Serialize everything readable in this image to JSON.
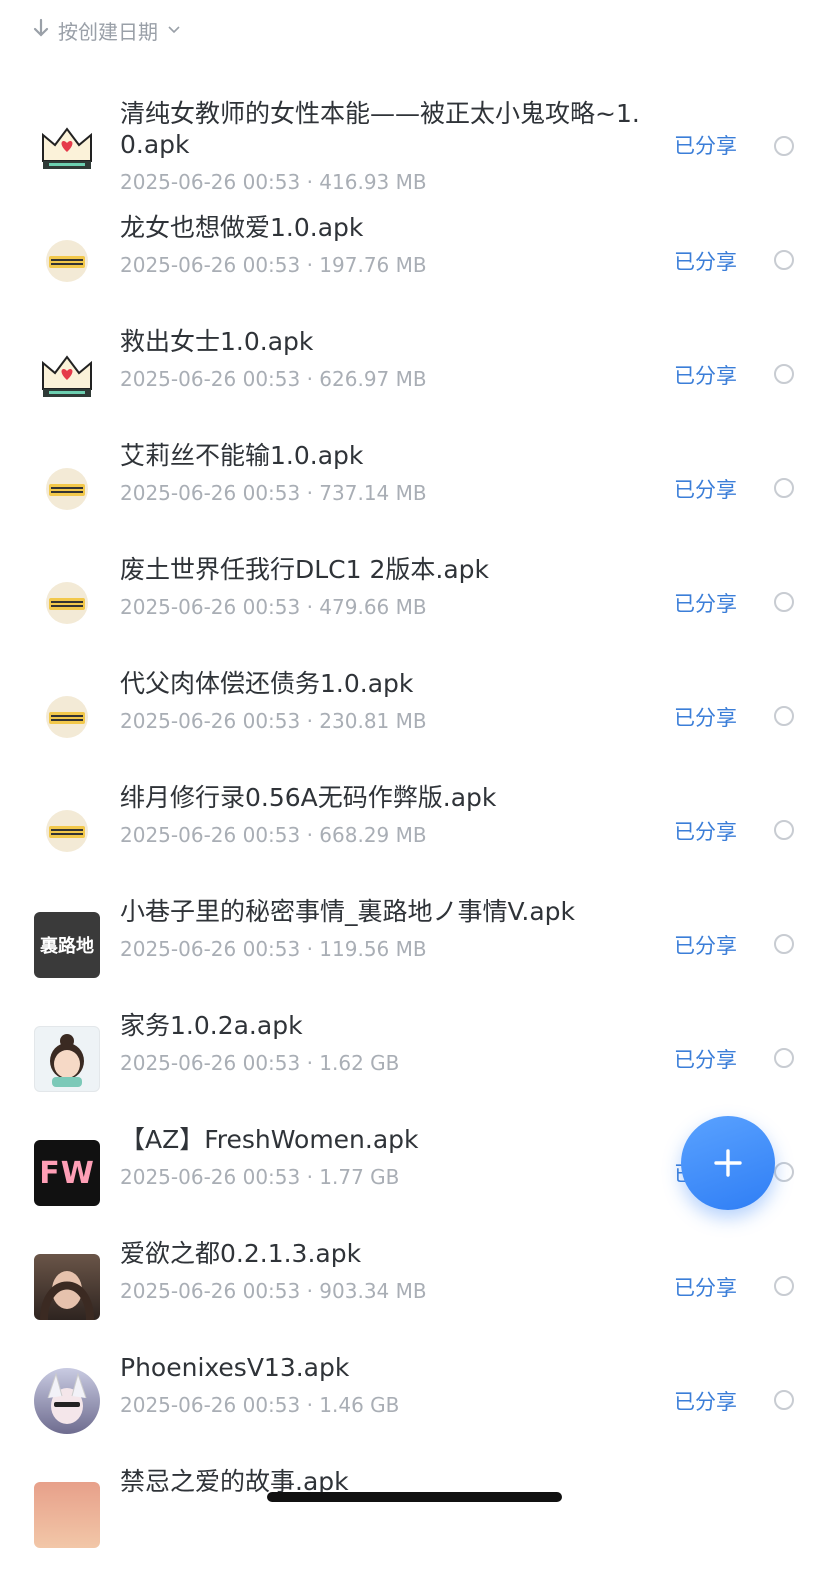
{
  "sort": {
    "label": "按创建日期"
  },
  "files": [
    {
      "name": "清纯女教师的女性本能——被正太小鬼攻略~1.0.apk",
      "meta": "2025-06-26 00:53 · 416.93 MB",
      "status": "已分享",
      "icon": "crown-icon"
    },
    {
      "name": "龙女也想做爱1.0.apk",
      "meta": "2025-06-26 00:53 · 197.76 MB",
      "status": "已分享",
      "icon": "site-logo-icon"
    },
    {
      "name": "救出女士1.0.apk",
      "meta": "2025-06-26 00:53 · 626.97 MB",
      "status": "已分享",
      "icon": "crown-icon"
    },
    {
      "name": "艾莉丝不能输1.0.apk",
      "meta": "2025-06-26 00:53 · 737.14 MB",
      "status": "已分享",
      "icon": "site-logo-icon"
    },
    {
      "name": "废土世界任我行DLC1 2版本.apk",
      "meta": "2025-06-26 00:53 · 479.66 MB",
      "status": "已分享",
      "icon": "site-logo-icon"
    },
    {
      "name": "代父肉体偿还债务1.0.apk",
      "meta": "2025-06-26 00:53 · 230.81 MB",
      "status": "已分享",
      "icon": "site-logo-icon"
    },
    {
      "name": "绯月修行录0.56A无码作弊版.apk",
      "meta": "2025-06-26 00:53 · 668.29 MB",
      "status": "已分享",
      "icon": "site-logo-icon"
    },
    {
      "name": "小巷子里的秘密事情_裏路地ノ事情V.apk",
      "meta": "2025-06-26 00:53 · 119.56 MB",
      "status": "已分享",
      "icon": "alley-game-icon"
    },
    {
      "name": "家务1.0.2a.apk",
      "meta": "2025-06-26 00:53 · 1.62 GB",
      "status": "已分享",
      "icon": "girl-avatar-icon"
    },
    {
      "name": "【AZ】FreshWomen.apk",
      "meta": "2025-06-26 00:53 · 1.77 GB",
      "status": "已分享",
      "icon": "fw-logo-icon"
    },
    {
      "name": "爱欲之都0.2.1.3.apk",
      "meta": "2025-06-26 00:53 · 903.34 MB",
      "status": "已分享",
      "icon": "portrait-icon"
    },
    {
      "name": "PhoenixesV13.apk",
      "meta": "2025-06-26 00:53 · 1.46 GB",
      "status": "已分享",
      "icon": "anime-avatar-icon"
    },
    {
      "name": "禁忌之爱的故事.apk",
      "meta": "",
      "status": "",
      "icon": "hat-character-icon"
    }
  ],
  "thumb_text": {
    "alley": "裏路地",
    "fw": "FW"
  },
  "fab": {
    "icon": "plus-icon"
  },
  "colors": {
    "accent": "#3b7ed8",
    "fab": "#2f7ef5",
    "meta": "#a9aeb5"
  }
}
